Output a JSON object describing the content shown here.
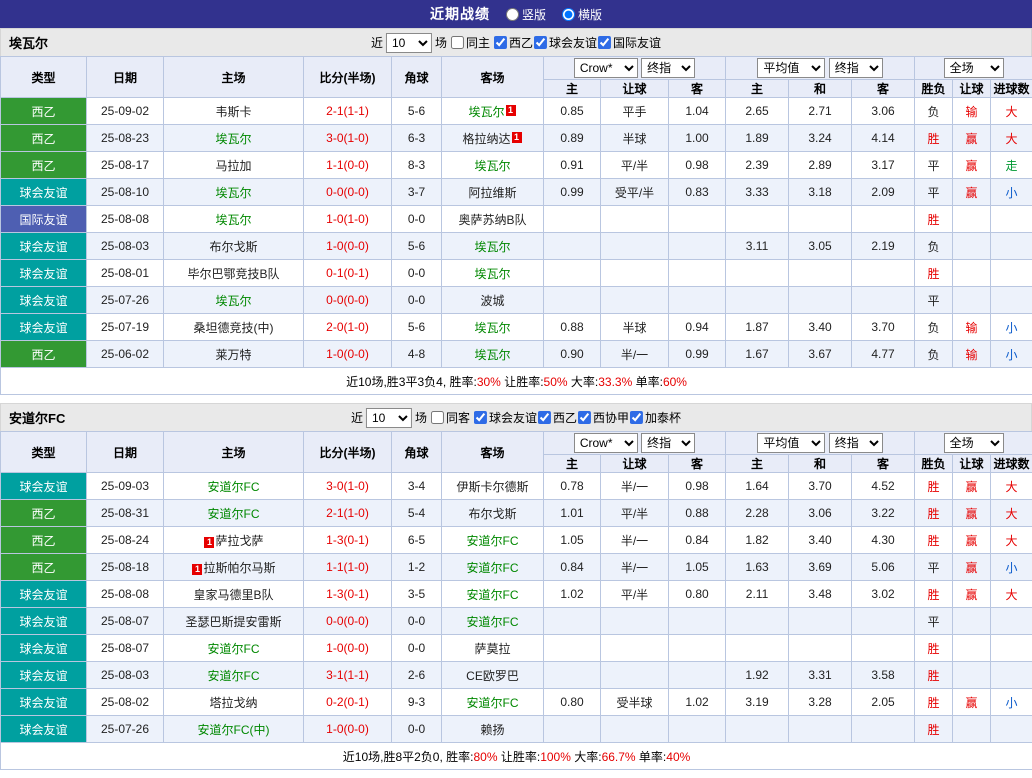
{
  "topbar": {
    "title": "近期战绩",
    "layout_options": [
      {
        "label": "竖版",
        "selected": false
      },
      {
        "label": "横版",
        "selected": true
      }
    ]
  },
  "colors": {
    "topbar_bg": "#32328e",
    "type_colors": {
      "西乙": "#339933",
      "球会友谊": "#00a0a0",
      "国际友谊": "#4e5fb2"
    },
    "focus_team": "#008800",
    "red": "#e60000",
    "blue": "#0b5bcc",
    "green": "#009933"
  },
  "sections": [
    {
      "team": "埃瓦尔",
      "filters": {
        "near_label": "近",
        "count": "10",
        "matches_label": "场",
        "same_venue": {
          "label": "同主",
          "checked": false
        },
        "leagues": [
          {
            "label": "西乙",
            "checked": true
          },
          {
            "label": "球会友谊",
            "checked": true
          },
          {
            "label": "国际友谊",
            "checked": true
          }
        ]
      },
      "header": {
        "static_cols": [
          "类型",
          "日期",
          "主场",
          "比分(半场)",
          "角球",
          "客场"
        ],
        "bookmaker_select": "Crow*",
        "bookmaker_index_select": "终指",
        "bookmaker_cols": [
          "主",
          "让球",
          "客"
        ],
        "average_select": "平均值",
        "average_index_select": "终指",
        "average_cols": [
          "主",
          "和",
          "客"
        ],
        "scope_select": "全场",
        "result_cols": [
          "胜负",
          "让球",
          "进球数"
        ]
      },
      "rows": [
        {
          "type": "西乙",
          "date": "25-09-02",
          "home": "韦斯卡",
          "home_focus": false,
          "home_badge": "",
          "score": "2-1(1-1)",
          "corners": "5-6",
          "away": "埃瓦尔",
          "away_focus": true,
          "away_badge": "1",
          "odds_home": "0.85",
          "handicap": "平手",
          "odds_away": "1.04",
          "avg_home": "2.65",
          "avg_draw": "2.71",
          "avg_away": "3.06",
          "result": "负",
          "result_color": "",
          "handicap_result": "输",
          "handicap_result_color": "red",
          "goals": "大",
          "goals_color": "red"
        },
        {
          "type": "西乙",
          "date": "25-08-23",
          "home": "埃瓦尔",
          "home_focus": true,
          "home_badge": "",
          "score": "3-0(1-0)",
          "corners": "6-3",
          "away": "格拉纳达",
          "away_focus": false,
          "away_badge": "1",
          "odds_home": "0.89",
          "handicap": "半球",
          "odds_away": "1.00",
          "avg_home": "1.89",
          "avg_draw": "3.24",
          "avg_away": "4.14",
          "result": "胜",
          "result_color": "red",
          "handicap_result": "赢",
          "handicap_result_color": "red",
          "goals": "大",
          "goals_color": "red"
        },
        {
          "type": "西乙",
          "date": "25-08-17",
          "home": "马拉加",
          "home_focus": false,
          "home_badge": "",
          "score": "1-1(0-0)",
          "corners": "8-3",
          "away": "埃瓦尔",
          "away_focus": true,
          "away_badge": "",
          "odds_home": "0.91",
          "handicap": "平/半",
          "odds_away": "0.98",
          "avg_home": "2.39",
          "avg_draw": "2.89",
          "avg_away": "3.17",
          "result": "平",
          "result_color": "",
          "handicap_result": "赢",
          "handicap_result_color": "red",
          "goals": "走",
          "goals_color": "green"
        },
        {
          "type": "球会友谊",
          "date": "25-08-10",
          "home": "埃瓦尔",
          "home_focus": true,
          "home_badge": "",
          "score": "0-0(0-0)",
          "corners": "3-7",
          "away": "阿拉维斯",
          "away_focus": false,
          "away_badge": "",
          "odds_home": "0.99",
          "handicap": "受平/半",
          "odds_away": "0.83",
          "avg_home": "3.33",
          "avg_draw": "3.18",
          "avg_away": "2.09",
          "result": "平",
          "result_color": "",
          "handicap_result": "赢",
          "handicap_result_color": "red",
          "goals": "小",
          "goals_color": "blue"
        },
        {
          "type": "国际友谊",
          "date": "25-08-08",
          "home": "埃瓦尔",
          "home_focus": true,
          "home_badge": "",
          "score": "1-0(1-0)",
          "corners": "0-0",
          "away": "奥萨苏纳B队",
          "away_focus": false,
          "away_badge": "",
          "odds_home": "",
          "handicap": "",
          "odds_away": "",
          "avg_home": "",
          "avg_draw": "",
          "avg_away": "",
          "result": "胜",
          "result_color": "red",
          "handicap_result": "",
          "handicap_result_color": "",
          "goals": "",
          "goals_color": ""
        },
        {
          "type": "球会友谊",
          "date": "25-08-03",
          "home": "布尔戈斯",
          "home_focus": false,
          "home_badge": "",
          "score": "1-0(0-0)",
          "corners": "5-6",
          "away": "埃瓦尔",
          "away_focus": true,
          "away_badge": "",
          "odds_home": "",
          "handicap": "",
          "odds_away": "",
          "avg_home": "3.11",
          "avg_draw": "3.05",
          "avg_away": "2.19",
          "result": "负",
          "result_color": "",
          "handicap_result": "",
          "handicap_result_color": "",
          "goals": "",
          "goals_color": ""
        },
        {
          "type": "球会友谊",
          "date": "25-08-01",
          "home": "毕尔巴鄂竞技B队",
          "home_focus": false,
          "home_badge": "",
          "score": "0-1(0-1)",
          "corners": "0-0",
          "away": "埃瓦尔",
          "away_focus": true,
          "away_badge": "",
          "odds_home": "",
          "handicap": "",
          "odds_away": "",
          "avg_home": "",
          "avg_draw": "",
          "avg_away": "",
          "result": "胜",
          "result_color": "red",
          "handicap_result": "",
          "handicap_result_color": "",
          "goals": "",
          "goals_color": ""
        },
        {
          "type": "球会友谊",
          "date": "25-07-26",
          "home": "埃瓦尔",
          "home_focus": true,
          "home_badge": "",
          "score": "0-0(0-0)",
          "corners": "0-0",
          "away": "波城",
          "away_focus": false,
          "away_badge": "",
          "odds_home": "",
          "handicap": "",
          "odds_away": "",
          "avg_home": "",
          "avg_draw": "",
          "avg_away": "",
          "result": "平",
          "result_color": "",
          "handicap_result": "",
          "handicap_result_color": "",
          "goals": "",
          "goals_color": ""
        },
        {
          "type": "球会友谊",
          "date": "25-07-19",
          "home": "桑坦德竞技(中)",
          "home_focus": false,
          "home_badge": "",
          "score": "2-0(1-0)",
          "corners": "5-6",
          "away": "埃瓦尔",
          "away_focus": true,
          "away_badge": "",
          "odds_home": "0.88",
          "handicap": "半球",
          "odds_away": "0.94",
          "avg_home": "1.87",
          "avg_draw": "3.40",
          "avg_away": "3.70",
          "result": "负",
          "result_color": "",
          "handicap_result": "输",
          "handicap_result_color": "red",
          "goals": "小",
          "goals_color": "blue"
        },
        {
          "type": "西乙",
          "date": "25-06-02",
          "home": "莱万特",
          "home_focus": false,
          "home_badge": "",
          "score": "1-0(0-0)",
          "corners": "4-8",
          "away": "埃瓦尔",
          "away_focus": true,
          "away_badge": "",
          "odds_home": "0.90",
          "handicap": "半/一",
          "odds_away": "0.99",
          "avg_home": "1.67",
          "avg_draw": "3.67",
          "avg_away": "4.77",
          "result": "负",
          "result_color": "",
          "handicap_result": "输",
          "handicap_result_color": "red",
          "goals": "小",
          "goals_color": "blue"
        }
      ],
      "summary": [
        {
          "text": "近10场,胜3平3负4, 胜率:",
          "color": ""
        },
        {
          "text": "30%",
          "color": "red"
        },
        {
          "text": " 让胜率:",
          "color": ""
        },
        {
          "text": "50%",
          "color": "red"
        },
        {
          "text": " 大率:",
          "color": ""
        },
        {
          "text": "33.3%",
          "color": "red"
        },
        {
          "text": " 单率:",
          "color": ""
        },
        {
          "text": "60%",
          "color": "red"
        }
      ]
    },
    {
      "team": "安道尔FC",
      "filters": {
        "near_label": "近",
        "count": "10",
        "matches_label": "场",
        "same_venue": {
          "label": "同客",
          "checked": false
        },
        "leagues": [
          {
            "label": "球会友谊",
            "checked": true
          },
          {
            "label": "西乙",
            "checked": true
          },
          {
            "label": "西协甲",
            "checked": true
          },
          {
            "label": "加泰杯",
            "checked": true
          }
        ]
      },
      "header": {
        "static_cols": [
          "类型",
          "日期",
          "主场",
          "比分(半场)",
          "角球",
          "客场"
        ],
        "bookmaker_select": "Crow*",
        "bookmaker_index_select": "终指",
        "bookmaker_cols": [
          "主",
          "让球",
          "客"
        ],
        "average_select": "平均值",
        "average_index_select": "终指",
        "average_cols": [
          "主",
          "和",
          "客"
        ],
        "scope_select": "全场",
        "result_cols": [
          "胜负",
          "让球",
          "进球数"
        ]
      },
      "rows": [
        {
          "type": "球会友谊",
          "date": "25-09-03",
          "home": "安道尔FC",
          "home_focus": true,
          "home_badge": "",
          "score": "3-0(1-0)",
          "corners": "3-4",
          "away": "伊斯卡尔德斯",
          "away_focus": false,
          "away_badge": "",
          "odds_home": "0.78",
          "handicap": "半/一",
          "odds_away": "0.98",
          "avg_home": "1.64",
          "avg_draw": "3.70",
          "avg_away": "4.52",
          "result": "胜",
          "result_color": "red",
          "handicap_result": "赢",
          "handicap_result_color": "red",
          "goals": "大",
          "goals_color": "red"
        },
        {
          "type": "西乙",
          "date": "25-08-31",
          "home": "安道尔FC",
          "home_focus": true,
          "home_badge": "",
          "score": "2-1(1-0)",
          "corners": "5-4",
          "away": "布尔戈斯",
          "away_focus": false,
          "away_badge": "",
          "odds_home": "1.01",
          "handicap": "平/半",
          "odds_away": "0.88",
          "avg_home": "2.28",
          "avg_draw": "3.06",
          "avg_away": "3.22",
          "result": "胜",
          "result_color": "red",
          "handicap_result": "赢",
          "handicap_result_color": "red",
          "goals": "大",
          "goals_color": "red"
        },
        {
          "type": "西乙",
          "date": "25-08-24",
          "home": "萨拉戈萨",
          "home_focus": false,
          "home_badge": "1",
          "score": "1-3(0-1)",
          "corners": "6-5",
          "away": "安道尔FC",
          "away_focus": true,
          "away_badge": "",
          "odds_home": "1.05",
          "handicap": "半/一",
          "odds_away": "0.84",
          "avg_home": "1.82",
          "avg_draw": "3.40",
          "avg_away": "4.30",
          "result": "胜",
          "result_color": "red",
          "handicap_result": "赢",
          "handicap_result_color": "red",
          "goals": "大",
          "goals_color": "red"
        },
        {
          "type": "西乙",
          "date": "25-08-18",
          "home": "拉斯帕尔马斯",
          "home_focus": false,
          "home_badge": "1",
          "score": "1-1(1-0)",
          "corners": "1-2",
          "away": "安道尔FC",
          "away_focus": true,
          "away_badge": "",
          "odds_home": "0.84",
          "handicap": "半/一",
          "odds_away": "1.05",
          "avg_home": "1.63",
          "avg_draw": "3.69",
          "avg_away": "5.06",
          "result": "平",
          "result_color": "",
          "handicap_result": "赢",
          "handicap_result_color": "red",
          "goals": "小",
          "goals_color": "blue"
        },
        {
          "type": "球会友谊",
          "date": "25-08-08",
          "home": "皇家马德里B队",
          "home_focus": false,
          "home_badge": "",
          "score": "1-3(0-1)",
          "corners": "3-5",
          "away": "安道尔FC",
          "away_focus": true,
          "away_badge": "",
          "odds_home": "1.02",
          "handicap": "平/半",
          "odds_away": "0.80",
          "avg_home": "2.11",
          "avg_draw": "3.48",
          "avg_away": "3.02",
          "result": "胜",
          "result_color": "red",
          "handicap_result": "赢",
          "handicap_result_color": "red",
          "goals": "大",
          "goals_color": "red"
        },
        {
          "type": "球会友谊",
          "date": "25-08-07",
          "home": "圣瑟巴斯提安雷斯",
          "home_focus": false,
          "home_badge": "",
          "score": "0-0(0-0)",
          "corners": "0-0",
          "away": "安道尔FC",
          "away_focus": true,
          "away_badge": "",
          "odds_home": "",
          "handicap": "",
          "odds_away": "",
          "avg_home": "",
          "avg_draw": "",
          "avg_away": "",
          "result": "平",
          "result_color": "",
          "handicap_result": "",
          "handicap_result_color": "",
          "goals": "",
          "goals_color": ""
        },
        {
          "type": "球会友谊",
          "date": "25-08-07",
          "home": "安道尔FC",
          "home_focus": true,
          "home_badge": "",
          "score": "1-0(0-0)",
          "corners": "0-0",
          "away": "萨莫拉",
          "away_focus": false,
          "away_badge": "",
          "odds_home": "",
          "handicap": "",
          "odds_away": "",
          "avg_home": "",
          "avg_draw": "",
          "avg_away": "",
          "result": "胜",
          "result_color": "red",
          "handicap_result": "",
          "handicap_result_color": "",
          "goals": "",
          "goals_color": ""
        },
        {
          "type": "球会友谊",
          "date": "25-08-03",
          "home": "安道尔FC",
          "home_focus": true,
          "home_badge": "",
          "score": "3-1(1-1)",
          "corners": "2-6",
          "away": "CE欧罗巴",
          "away_focus": false,
          "away_badge": "",
          "odds_home": "",
          "handicap": "",
          "odds_away": "",
          "avg_home": "1.92",
          "avg_draw": "3.31",
          "avg_away": "3.58",
          "result": "胜",
          "result_color": "red",
          "handicap_result": "",
          "handicap_result_color": "",
          "goals": "",
          "goals_color": ""
        },
        {
          "type": "球会友谊",
          "date": "25-08-02",
          "home": "塔拉戈纳",
          "home_focus": false,
          "home_badge": "",
          "score": "0-2(0-1)",
          "corners": "9-3",
          "away": "安道尔FC",
          "away_focus": true,
          "away_badge": "",
          "odds_home": "0.80",
          "handicap": "受半球",
          "odds_away": "1.02",
          "avg_home": "3.19",
          "avg_draw": "3.28",
          "avg_away": "2.05",
          "result": "胜",
          "result_color": "red",
          "handicap_result": "赢",
          "handicap_result_color": "red",
          "goals": "小",
          "goals_color": "blue"
        },
        {
          "type": "球会友谊",
          "date": "25-07-26",
          "home": "安道尔FC(中)",
          "home_focus": true,
          "home_badge": "",
          "score": "1-0(0-0)",
          "corners": "0-0",
          "away": "赖扬",
          "away_focus": false,
          "away_badge": "",
          "odds_home": "",
          "handicap": "",
          "odds_away": "",
          "avg_home": "",
          "avg_draw": "",
          "avg_away": "",
          "result": "胜",
          "result_color": "red",
          "handicap_result": "",
          "handicap_result_color": "",
          "goals": "",
          "goals_color": ""
        }
      ],
      "summary": [
        {
          "text": "近10场,胜8平2负0, 胜率:",
          "color": ""
        },
        {
          "text": "80%",
          "color": "red"
        },
        {
          "text": " 让胜率:",
          "color": ""
        },
        {
          "text": "100%",
          "color": "red"
        },
        {
          "text": " 大率:",
          "color": ""
        },
        {
          "text": "66.7%",
          "color": "red"
        },
        {
          "text": " 单率:",
          "color": ""
        },
        {
          "text": "40%",
          "color": "red"
        }
      ]
    }
  ]
}
